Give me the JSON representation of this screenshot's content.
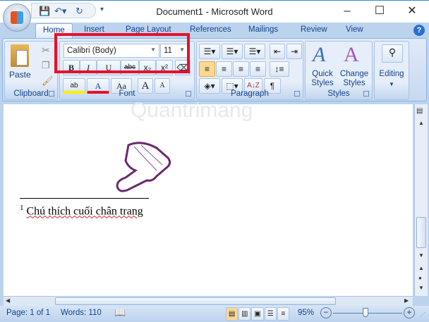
{
  "title": "Document1 - Microsoft Word",
  "tabs": [
    "Home",
    "Insert",
    "Page Layout",
    "References",
    "Mailings",
    "Review",
    "View"
  ],
  "groups": {
    "clipboard": "Clipboard",
    "font": "Font",
    "paragraph": "Paragraph",
    "styles": "Styles"
  },
  "clipboard": {
    "paste": "Paste"
  },
  "font": {
    "name": "Calibri (Body)",
    "size": "11",
    "bold": "B",
    "italic": "I",
    "underline": "U",
    "strike": "abc",
    "subscript": "x₂",
    "superscript": "x²",
    "change_case": "Aa",
    "grow": "A",
    "shrink": "A",
    "font_color": "A",
    "highlight": "ab"
  },
  "paragraph": {
    "sort": "A↓Z",
    "pilcrow": "¶"
  },
  "styles": {
    "quick": "Quick Styles",
    "change": "Change Styles"
  },
  "editing": "Editing",
  "document": {
    "footnote_number": "1",
    "footnote_text": "Chú thích cuối chân trang",
    "watermark": "Quantrimang"
  },
  "status": {
    "page": "Page: 1 of 1",
    "words": "Words: 110",
    "zoom": "95%"
  },
  "zoom_percent": 95,
  "accent": "#e8102a"
}
